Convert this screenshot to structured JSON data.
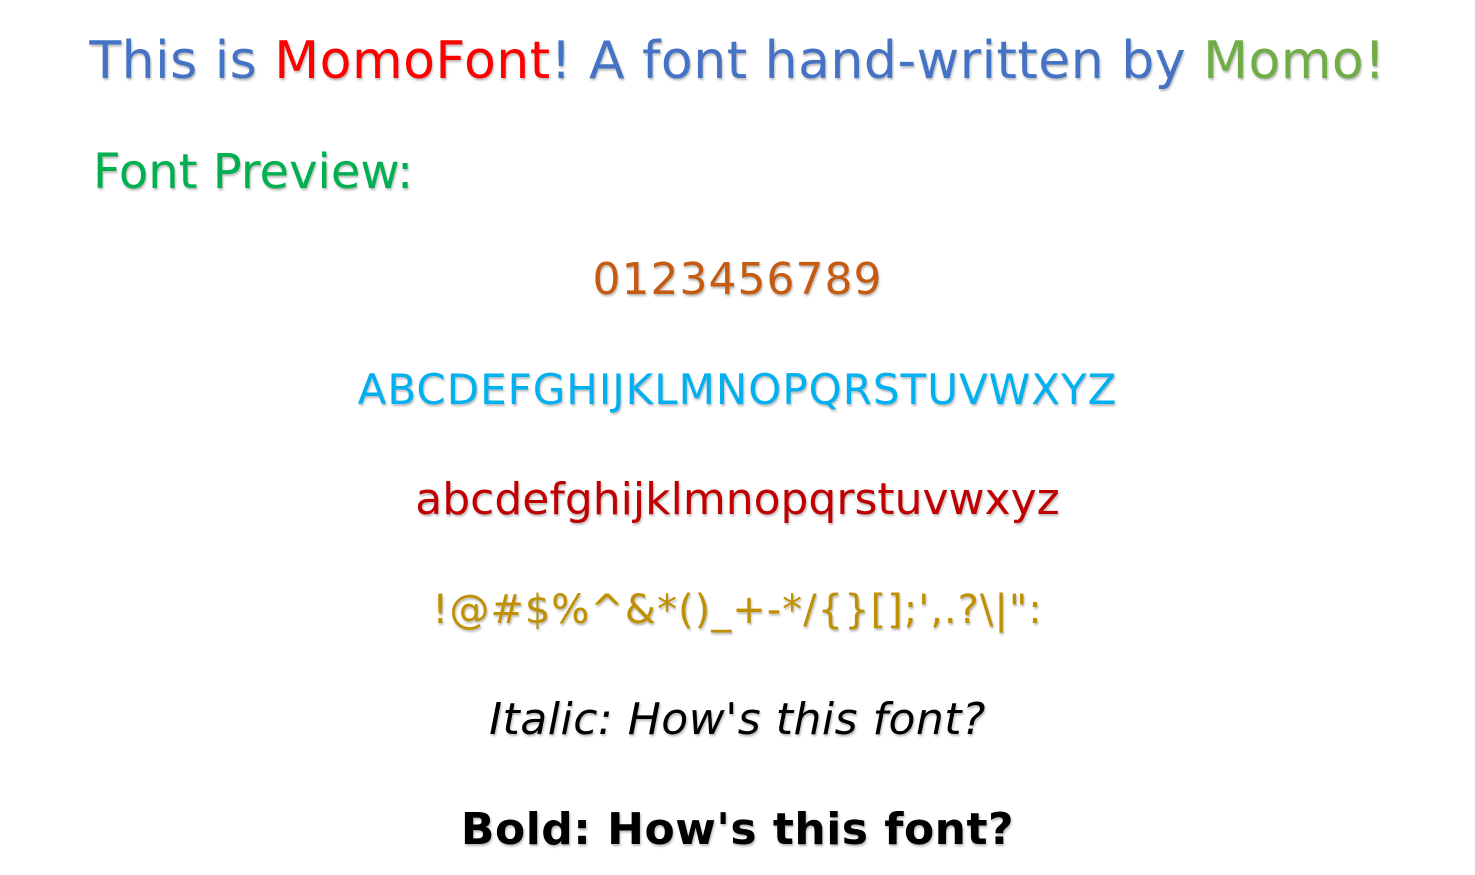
{
  "title": {
    "part1": "This is ",
    "part2": "MomoFont",
    "part3": "! A font hand-written by ",
    "part4": "Momo!"
  },
  "preview": {
    "heading": "Font Preview:",
    "digits": "0123456789",
    "uppercase": "ABCDEFGHIJKLMNOPQRSTUVWXYZ",
    "lowercase": "abcdefghijklmnopqrstuvwxyz",
    "symbols": "!@#$%^&*()_+-*/{}[];',.?\\|\":",
    "italic_sample": "Italic: How's this font?",
    "bold_sample": "Bold: How's this font?"
  },
  "colors": {
    "title_blue": "#4472c4",
    "title_red": "#ff0000",
    "title_green": "#70ad47",
    "heading_green": "#00b050",
    "digits_orange": "#c55a11",
    "upper_blue": "#00b0f0",
    "lower_red": "#c00000",
    "symbols_gold": "#bf9000",
    "black": "#000000"
  }
}
